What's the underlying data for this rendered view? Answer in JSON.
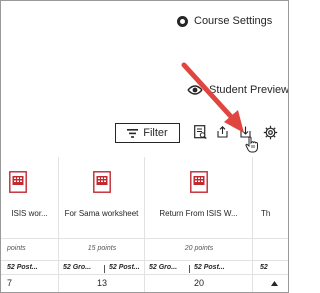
{
  "header": {
    "course_settings_label": "Course Settings"
  },
  "preview": {
    "student_preview_label": "Student Preview"
  },
  "toolbar": {
    "filter_label": "Filter"
  },
  "columns": [
    {
      "title": "ISIS wor...",
      "points": "points",
      "stats": [
        "52 Post..."
      ],
      "num": "7"
    },
    {
      "title": "For Sama worksheet",
      "points": "15 points",
      "stats": [
        "52 Gro...",
        "52 Post..."
      ],
      "num": "13"
    },
    {
      "title": "Return From ISIS W...",
      "points": "20 points",
      "stats": [
        "52 Gro...",
        "52 Post..."
      ],
      "num": "20"
    },
    {
      "title": "Th",
      "points": "",
      "stats": [
        "52"
      ],
      "num": ""
    }
  ],
  "colors": {
    "accent_red": "#c0292f",
    "arrow_red": "#e0463f",
    "text": "#262626"
  },
  "icons": [
    "gear-icon",
    "eye-icon",
    "filter-icon",
    "grade-report-icon",
    "upload-icon",
    "download-icon",
    "hand-cursor-icon",
    "settings-icon",
    "document-icon",
    "up-arrow-icon"
  ]
}
